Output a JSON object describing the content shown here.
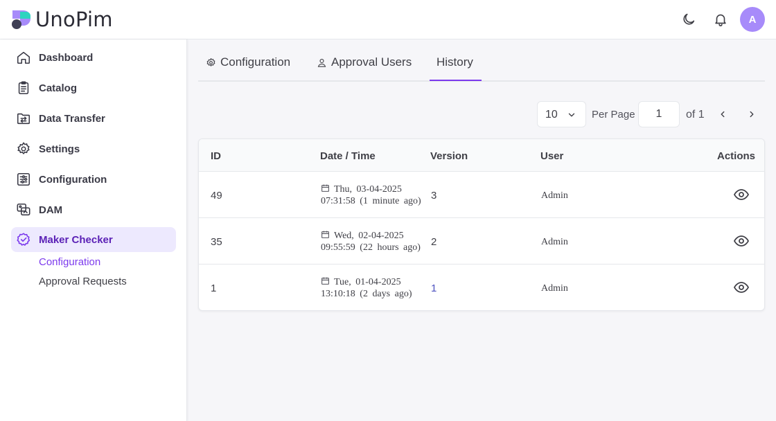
{
  "header": {
    "logo_text": "UnoPim",
    "avatar_initial": "A"
  },
  "sidebar": {
    "items": [
      {
        "label": "Dashboard",
        "icon": "home-icon"
      },
      {
        "label": "Catalog",
        "icon": "clipboard-icon"
      },
      {
        "label": "Data Transfer",
        "icon": "folder-transfer-icon"
      },
      {
        "label": "Settings",
        "icon": "gear-icon"
      },
      {
        "label": "Configuration",
        "icon": "sliders-icon"
      },
      {
        "label": "DAM",
        "icon": "media-icon"
      },
      {
        "label": "Maker Checker",
        "icon": "badge-check-icon",
        "active": true
      }
    ],
    "sub_items": [
      {
        "label": "Configuration",
        "active": true
      },
      {
        "label": "Approval Requests",
        "active": false
      }
    ]
  },
  "tabs": [
    {
      "label": "Configuration",
      "icon": "gear-icon"
    },
    {
      "label": "Approval Users",
      "icon": "user-icon"
    },
    {
      "label": "History",
      "active": true
    }
  ],
  "pager": {
    "per_page_value": "10",
    "per_page_label": "Per Page",
    "current_page": "1",
    "of_label": "of 1"
  },
  "table": {
    "columns": [
      "ID",
      "Date / Time",
      "Version",
      "User",
      "Actions"
    ],
    "rows": [
      {
        "id": "49",
        "date_line1": "Thu, 03-04-2025",
        "date_line2": "07:31:58 (1 minute ago)",
        "version": "3",
        "user": "Admin"
      },
      {
        "id": "35",
        "date_line1": "Wed, 02-04-2025",
        "date_line2": "09:55:59 (22 hours ago)",
        "version": "2",
        "user": "Admin"
      },
      {
        "id": "1",
        "date_line1": "Tue, 01-04-2025",
        "date_line2": "13:10:18 (2 days ago)",
        "version": "1",
        "user": "Admin"
      }
    ]
  },
  "colors": {
    "accent": "#7c3aed",
    "active_bg": "#ede9fe",
    "avatar_bg": "#a78bfa"
  }
}
